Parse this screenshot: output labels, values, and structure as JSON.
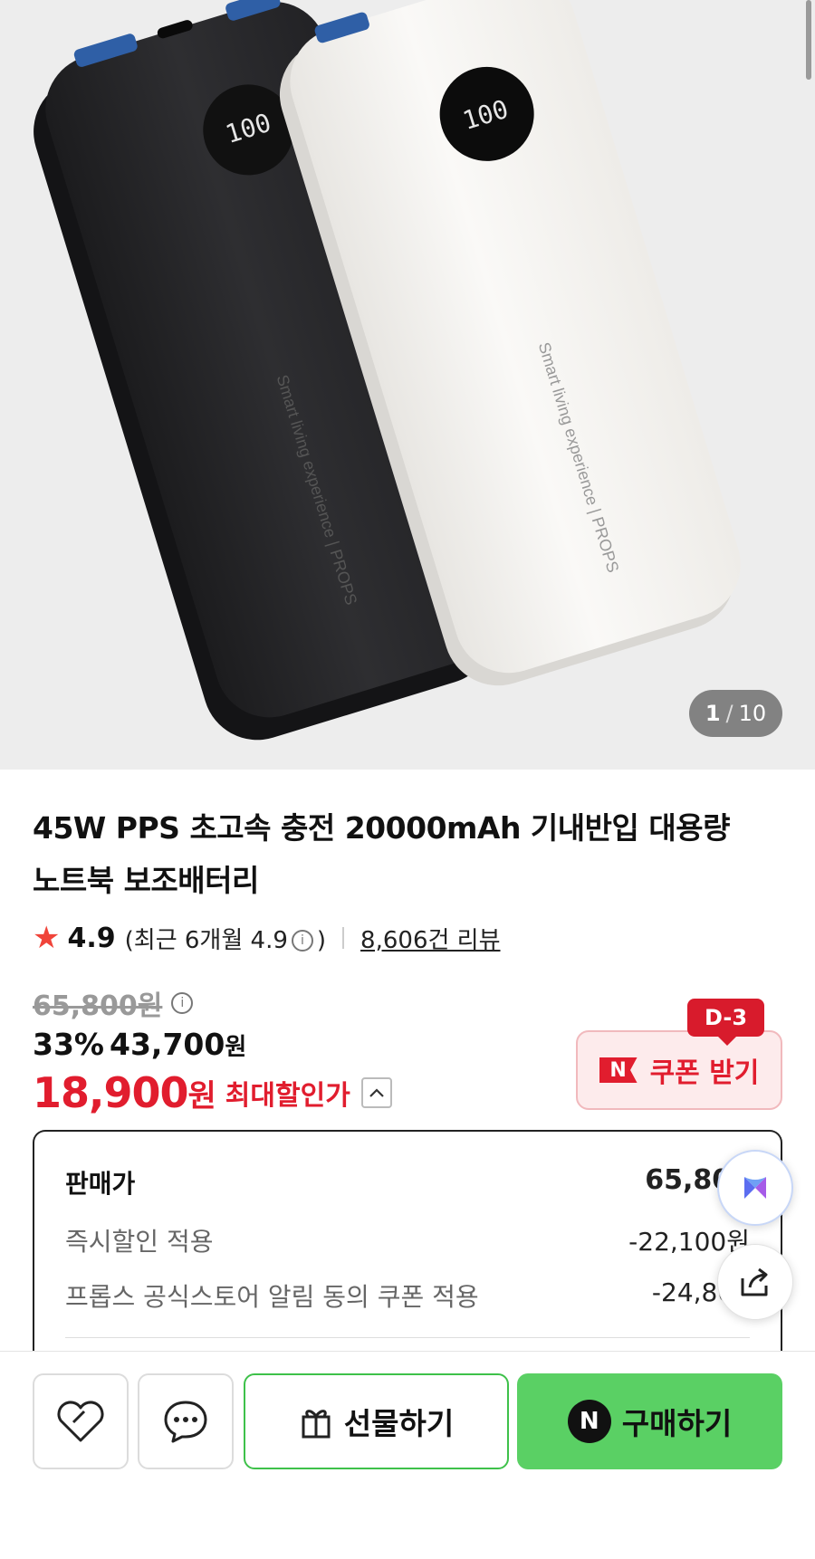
{
  "gallery": {
    "current": "1",
    "separator": "/",
    "total": "10",
    "product_brand_text": "Smart living experience | PROPS",
    "display_text": "100"
  },
  "product": {
    "title_line1": "45W PPS 초고속 충전 20000mAh 기내반입 대용량",
    "title_line2": "노트북 보조배터리"
  },
  "rating": {
    "star": "★",
    "score": "4.9",
    "recent_prefix": "(최근 6개월 4.9",
    "recent_suffix": ")",
    "info_icon": "i",
    "review_count": "8,606건 리뷰"
  },
  "price": {
    "original": "65,800원",
    "discount_pct": "33%",
    "sale_amount": "43,700",
    "sale_unit": "원",
    "max_amount": "18,900",
    "max_unit": "원",
    "max_label": "최대할인가",
    "caret": "^"
  },
  "coupon": {
    "dday": "D-3",
    "logo": "N",
    "label": "쿠폰 받기"
  },
  "breakdown": {
    "rows": [
      {
        "label": "판매가",
        "value": "65,800"
      },
      {
        "label": "즉시할인 적용",
        "value": "-22,100원"
      },
      {
        "label": "프롭스 공식스토어 알림 동의 쿠폰 적용",
        "value": "-24,800"
      }
    ]
  },
  "bottom": {
    "gift_label": "선물하기",
    "buy_logo": "N",
    "buy_label": "구매하기"
  },
  "colors": {
    "accent_red": "#e11d2e",
    "buy_green": "#5ad064",
    "gift_border": "#3ec14a"
  }
}
